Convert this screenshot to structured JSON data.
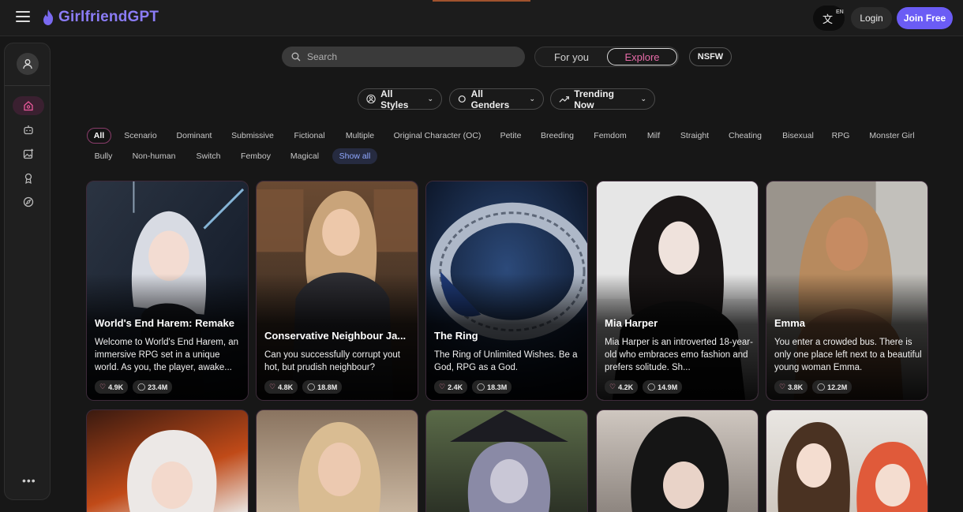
{
  "header": {
    "brand": "GirlfriendGPT",
    "lang_code": "EN",
    "login_label": "Login",
    "join_label": "Join Free"
  },
  "search": {
    "placeholder": "Search"
  },
  "feed_tabs": {
    "for_you": "For you",
    "explore": "Explore",
    "active": "Explore"
  },
  "nsfw_label": "NSFW",
  "filters": {
    "styles": "All Styles",
    "genders": "All Genders",
    "sort": "Trending Now"
  },
  "tags": [
    "All",
    "Scenario",
    "Dominant",
    "Submissive",
    "Fictional",
    "Multiple",
    "Original Character (OC)",
    "Petite",
    "Breeding",
    "Femdom",
    "Milf",
    "Straight",
    "Cheating",
    "Bisexual",
    "RPG",
    "Monster Girl",
    "Bully",
    "Non-human",
    "Switch",
    "Femboy",
    "Magical",
    "Show all"
  ],
  "active_tag": "All",
  "cards": [
    {
      "title": "World's End Harem: Remake",
      "desc": "Welcome to World's End Harem, an immersive RPG set in a unique world. As you, the player, awake...",
      "likes": "4.9K",
      "chats": "23.4M"
    },
    {
      "title": "Conservative Neighbour Ja...",
      "desc": "Can you successfully corrupt yout hot, but prudish neighbour?",
      "likes": "4.8K",
      "chats": "18.8M"
    },
    {
      "title": "The Ring",
      "desc": "The Ring of Unlimited Wishes. Be a God, RPG as a God.",
      "likes": "2.4K",
      "chats": "18.3M"
    },
    {
      "title": "Mia Harper",
      "desc": "Mia Harper is an introverted 18-year-old who embraces emo fashion and prefers solitude. Sh...",
      "likes": "4.2K",
      "chats": "14.9M"
    },
    {
      "title": "Emma",
      "desc": "You enter a crowded bus. There is only one place left next to a beautiful young woman Emma.",
      "likes": "3.8K",
      "chats": "12.2M"
    }
  ],
  "colors": {
    "brand": "#8b7cf6",
    "join": "#6b5cf5",
    "explore_accent": "#e76ba8",
    "show_all": "#8fa8ff"
  },
  "icons": {
    "menu": "hamburger-icon",
    "logo": "flame-icon",
    "translate": "translate-icon",
    "search": "search-icon",
    "sidebar": [
      "home-icon",
      "bot-icon",
      "image-generate-icon",
      "award-icon",
      "compass-icon",
      "more-icon"
    ]
  }
}
